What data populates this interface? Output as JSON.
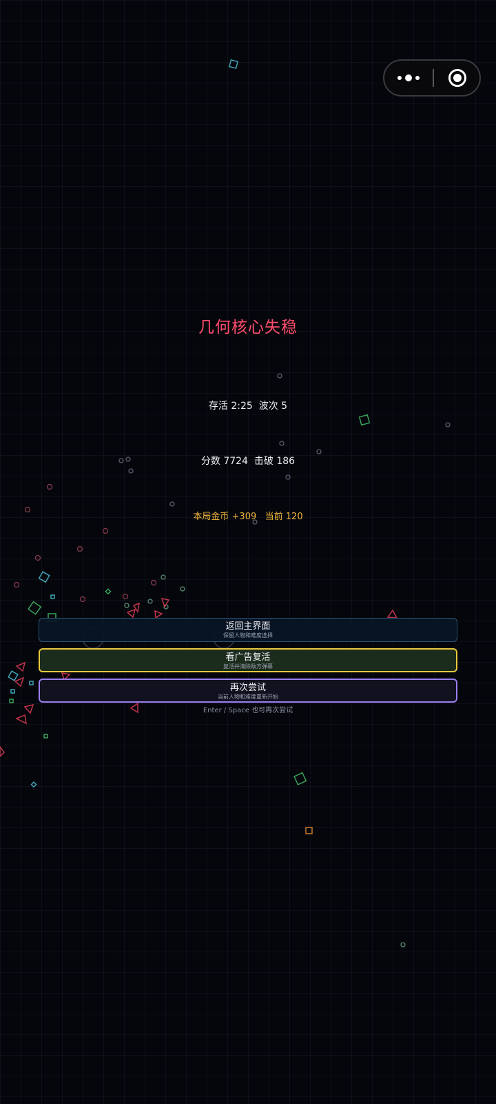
{
  "capsule": {
    "more_icon": "more-dots-icon",
    "close_icon": "target-close-icon"
  },
  "game_over": {
    "title": "几何核心失稳",
    "title_color": "#ff4d6d",
    "stats": {
      "survival_line": "存活 2:25  波次 5",
      "score_line": "分数 7724  击破 186",
      "coins_line": "本局金币 +309   当前 120"
    },
    "buttons": [
      {
        "label": "返回主界面",
        "sublabel": "保留人物和难度选择"
      },
      {
        "label": "看广告复活",
        "sublabel": "复活并清除敌方弹幕"
      },
      {
        "label": "再次尝试",
        "sublabel": "当前人物和难度重新开始"
      }
    ],
    "hint": "Enter / Space 也可再次尝试"
  },
  "colors": {
    "background": "#05060b",
    "coin": "#f2b83c",
    "home_border": "#2a5676",
    "revive_border": "#e8c93e",
    "retry_border": "#9a7ff0"
  }
}
